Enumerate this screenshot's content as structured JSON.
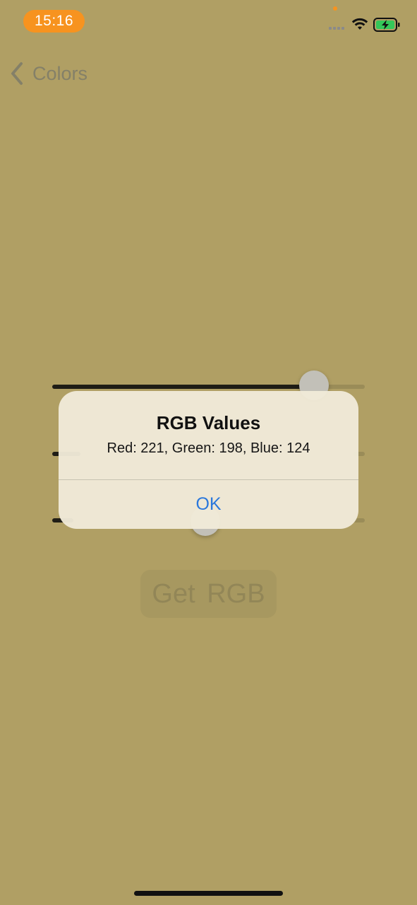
{
  "status_bar": {
    "time": "15:16",
    "icons": [
      "signal-icon",
      "wifi-icon",
      "battery-charging-icon"
    ]
  },
  "nav": {
    "back_label": "Colors",
    "back_icon": "chevron-left-icon"
  },
  "sliders": [
    {
      "name": "red",
      "value": 221,
      "max": 255
    },
    {
      "name": "green",
      "value": 198,
      "max": 255
    },
    {
      "name": "blue",
      "value": 124,
      "max": 255
    }
  ],
  "button": {
    "label": "Get RGB"
  },
  "alert": {
    "title": "RGB Values",
    "message": "Red: 221, Green: 198, Blue: 124",
    "ok_label": "OK"
  },
  "colors": {
    "background": "#b09f64",
    "accent": "#2b78dc",
    "time_pill": "#f7931f",
    "battery": "#34c759"
  }
}
